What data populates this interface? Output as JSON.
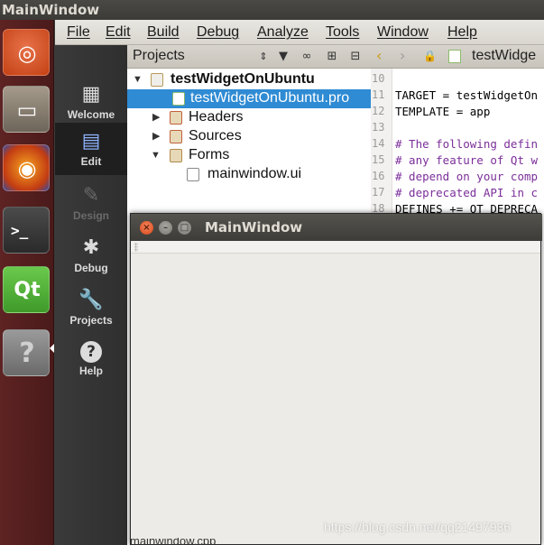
{
  "topbar": {
    "title": "MainWindow"
  },
  "launcher": {
    "items": [
      {
        "name": "ubuntu",
        "glyph": "◎"
      },
      {
        "name": "files",
        "glyph": "▭"
      },
      {
        "name": "firefox",
        "glyph": "◉"
      },
      {
        "name": "terminal",
        "glyph": ">_"
      },
      {
        "name": "qt-creator",
        "glyph": "Qt"
      },
      {
        "name": "help",
        "glyph": "?"
      }
    ]
  },
  "menubar": {
    "items": [
      "File",
      "Edit",
      "Build",
      "Debug",
      "Analyze",
      "Tools",
      "Window",
      "Help"
    ]
  },
  "modes": [
    {
      "label": "Welcome",
      "icon": "grid-icon",
      "glyph": "▦"
    },
    {
      "label": "Edit",
      "icon": "document-icon",
      "glyph": "▤"
    },
    {
      "label": "Design",
      "icon": "pencil-icon",
      "glyph": "✎"
    },
    {
      "label": "Debug",
      "icon": "bug-icon",
      "glyph": "✱"
    },
    {
      "label": "Projects",
      "icon": "wrench-icon",
      "glyph": "🔧"
    },
    {
      "label": "Help",
      "icon": "help-icon",
      "glyph": "?"
    }
  ],
  "projects": {
    "title": "Projects",
    "tree": [
      {
        "label": "testWidgetOnUbuntu",
        "level": 0,
        "expanded": true,
        "bold": true,
        "icon": "project-folder-icon"
      },
      {
        "label": "testWidgetOnUbuntu.pro",
        "level": 1,
        "selected": true,
        "icon": "pro-file-icon"
      },
      {
        "label": "Headers",
        "level": 1,
        "expanded": false,
        "icon": "headers-folder-icon"
      },
      {
        "label": "Sources",
        "level": 1,
        "expanded": false,
        "icon": "sources-folder-icon"
      },
      {
        "label": "Forms",
        "level": 1,
        "expanded": true,
        "icon": "forms-folder-icon"
      },
      {
        "label": "mainwindow.ui",
        "level": 2,
        "icon": "ui-file-icon"
      }
    ]
  },
  "editor": {
    "tab_title": "testWidge",
    "lines": [
      {
        "num": "10",
        "text": ""
      },
      {
        "num": "11",
        "text": "TARGET = testWidgetOn"
      },
      {
        "num": "12",
        "text": "TEMPLATE = app"
      },
      {
        "num": "13",
        "text": ""
      },
      {
        "num": "14",
        "text": "# The following defin"
      },
      {
        "num": "15",
        "text": "# any feature of Qt w"
      },
      {
        "num": "16",
        "text": "# depend on your comp"
      },
      {
        "num": "17",
        "text": "# deprecated API in c"
      },
      {
        "num": "18",
        "text": "DEFINES += QT_DEPRECA"
      }
    ]
  },
  "mainwindow": {
    "title": "MainWindow"
  },
  "watermark": "https://blog.csdn.net/qq21497936",
  "bottom_strip": "mainwindow.cpp",
  "colors": {
    "selection": "#2f8bd3",
    "launcher": "#5e2323",
    "close_button": "#e4552b"
  }
}
